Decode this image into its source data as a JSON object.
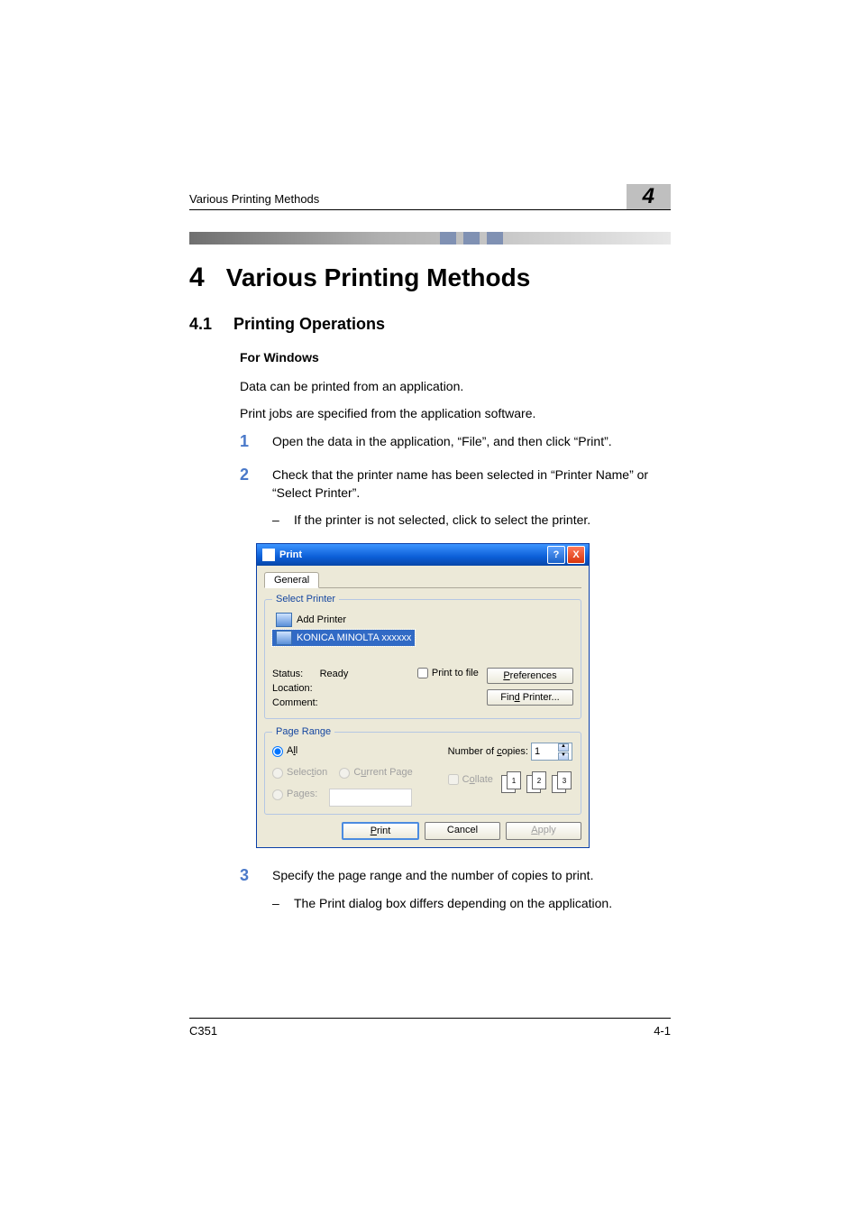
{
  "header": {
    "running_title": "Various Printing Methods",
    "badge": "4"
  },
  "h1": {
    "num": "4",
    "text": "Various Printing Methods"
  },
  "h2": {
    "num": "4.1",
    "text": "Printing Operations"
  },
  "h3": "For Windows",
  "para1": "Data can be printed from an application.",
  "para2": "Print jobs are specified from the application software.",
  "steps": {
    "s1": {
      "n": "1",
      "t": "Open the data in the application, “File”, and then click “Print”."
    },
    "s2": {
      "n": "2",
      "t": "Check that the printer name has been selected in “Printer Name” or “Select Printer”.",
      "sub": "If the printer is not selected, click to select the printer."
    },
    "s3": {
      "n": "3",
      "t": "Specify the page range and the number of copies to print.",
      "sub": "The Print dialog box differs depending on the application."
    }
  },
  "dlg": {
    "title": "Print",
    "help": "?",
    "close": "X",
    "tab_general": "General",
    "select_printer": {
      "legend": "Select Printer",
      "add": "Add Printer",
      "printer": "KONICA MINOLTA xxxxxx",
      "status_lbl": "Status:",
      "status_val": "Ready",
      "location_lbl": "Location:",
      "comment_lbl": "Comment:",
      "print_to_file": "Print to file",
      "preferences": "Preferences",
      "find_printer": "Find Printer..."
    },
    "page_range": {
      "legend": "Page Range",
      "all": "All",
      "selection": "Selection",
      "current": "Current Page",
      "pages": "Pages:",
      "copies_lbl": "Number of copies:",
      "copies_val": "1",
      "collate": "Collate",
      "stack1a": "1",
      "stack1b": "1",
      "stack2a": "2",
      "stack2b": "2",
      "stack3a": "3",
      "stack3b": "3"
    },
    "actions": {
      "print": "Print",
      "cancel": "Cancel",
      "apply": "Apply"
    }
  },
  "footer": {
    "left": "C351",
    "right": "4-1"
  }
}
